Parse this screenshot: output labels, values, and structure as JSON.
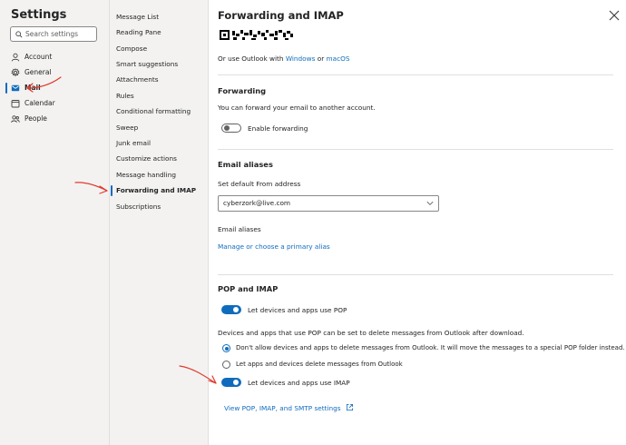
{
  "settings": {
    "title": "Settings",
    "search_placeholder": "Search settings"
  },
  "nav": {
    "items": [
      {
        "label": "Account",
        "icon": "account-icon"
      },
      {
        "label": "General",
        "icon": "gear-icon"
      },
      {
        "label": "Mail",
        "icon": "mail-icon",
        "active": true
      },
      {
        "label": "Calendar",
        "icon": "calendar-icon"
      },
      {
        "label": "People",
        "icon": "people-icon"
      }
    ]
  },
  "submenu": {
    "items": [
      {
        "label": "Message List"
      },
      {
        "label": "Reading Pane"
      },
      {
        "label": "Compose"
      },
      {
        "label": "Smart suggestions"
      },
      {
        "label": "Attachments"
      },
      {
        "label": "Rules"
      },
      {
        "label": "Conditional formatting"
      },
      {
        "label": "Sweep"
      },
      {
        "label": "Junk email"
      },
      {
        "label": "Customize actions"
      },
      {
        "label": "Message handling"
      },
      {
        "label": "Forwarding and IMAP",
        "active": true
      },
      {
        "label": "Subscriptions"
      }
    ]
  },
  "panel": {
    "title": "Forwarding and IMAP",
    "outlook_text": "Or use Outlook with",
    "windows_link": "Windows",
    "or_text": "or",
    "macos_link": "macOS",
    "forwarding": {
      "heading": "Forwarding",
      "description": "You can forward your email to another account.",
      "toggle_label": "Enable forwarding",
      "enabled": false
    },
    "aliases": {
      "heading": "Email aliases",
      "default_from_label": "Set default From address",
      "default_from_value": "cyberzork@live.com",
      "aliases_label": "Email aliases",
      "manage_link": "Manage or choose a primary alias"
    },
    "pop_imap": {
      "heading": "POP and IMAP",
      "pop_label": "Let devices and apps use POP",
      "pop_enabled": true,
      "pop_description": "Devices and apps that use POP can be set to delete messages from Outlook after download.",
      "radio_dont_delete": "Don't allow devices and apps to delete messages from Outlook. It will move the messages to a special POP folder instead.",
      "radio_delete": "Let apps and devices delete messages from Outlook",
      "selected": "dont_delete",
      "imap_label": "Let devices and apps use IMAP",
      "imap_enabled": true,
      "settings_link": "View POP, IMAP, and SMTP settings"
    }
  },
  "colors": {
    "accent": "#0f6cbd",
    "annotation": "#e03a2f",
    "sidebar_bg": "#f3f2f1"
  }
}
